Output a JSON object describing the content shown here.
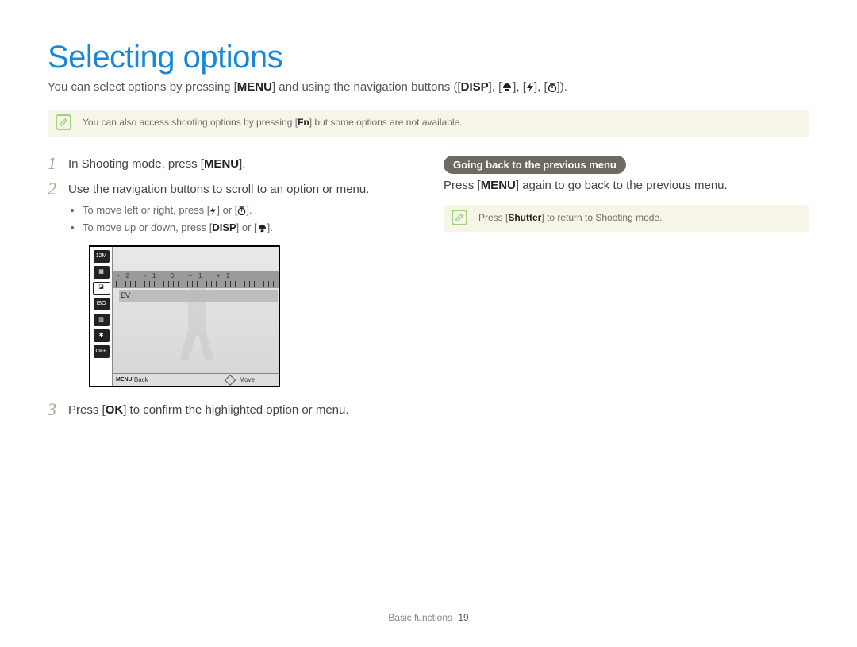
{
  "title": "Selecting options",
  "intro": {
    "before": "You can select options by pressing [",
    "menu": "MENU",
    "mid": "] and using the navigation buttons ([",
    "disp": "DISP",
    "after": "]).",
    "sep": "], ["
  },
  "note1": {
    "before": "You can also access shooting options by pressing [",
    "fn": "Fn",
    "after": "] but some options are not available."
  },
  "steps": {
    "s1": {
      "before": "In Shooting mode, press [",
      "menu": "MENU",
      "after": "]."
    },
    "s2": {
      "text": "Use the navigation buttons to scroll to an option or menu.",
      "b1": {
        "before": "To move left or right, press [",
        "mid": "] or [",
        "after": "]."
      },
      "b2": {
        "before": "To move up or down, press [",
        "disp": "DISP",
        "mid": "] or [",
        "after": "]."
      }
    },
    "s3": {
      "before": "Press [",
      "ok": "OK",
      "after": "] to confirm the highlighted option or menu."
    }
  },
  "lcd": {
    "evscale": "-2   -1    0   +1   +2",
    "evlabel": "EV",
    "back": "Back",
    "move": "Move",
    "menu": "MENU",
    "side": {
      "i1": "12M",
      "i2": "▦",
      "i3": "◪",
      "i4": "ISO",
      "i5": "▥",
      "i6": "✱",
      "i7": "OFF"
    }
  },
  "right": {
    "heading": "Going back to the previous menu",
    "p": {
      "before": "Press [",
      "menu": "MENU",
      "after": "] again to go back to the previous menu."
    },
    "note": {
      "before": "Press [",
      "shutter": "Shutter",
      "after": "] to return to Shooting mode."
    }
  },
  "footer": {
    "section": "Basic functions",
    "page": "19"
  }
}
